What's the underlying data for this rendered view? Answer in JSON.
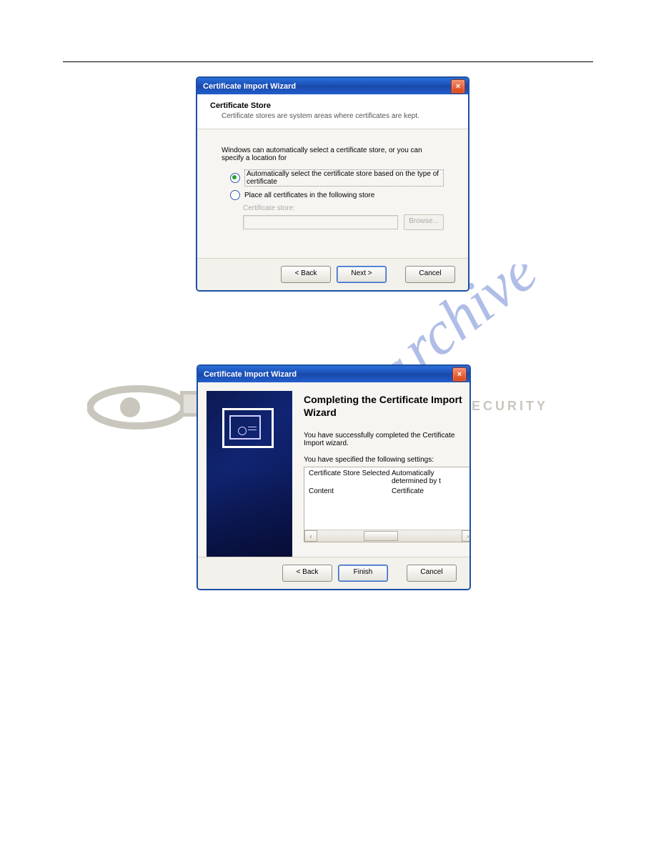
{
  "brand": {
    "watermark_text": "manualchive.com",
    "logo_text": "SECURITY",
    "tm": "®"
  },
  "dialog1": {
    "title": "Certificate Import Wizard",
    "header_title": "Certificate Store",
    "header_sub": "Certificate stores are system areas where certificates are kept.",
    "intro": "Windows can automatically select a certificate store, or you can specify a location for",
    "radio_auto": "Automatically select the certificate store based on the type of certificate",
    "radio_manual": "Place all certificates in the following store",
    "store_label": "Certificate store:",
    "store_value": "",
    "browse": "Browse...",
    "back": "< Back",
    "next": "Next >",
    "cancel": "Cancel",
    "close": "×"
  },
  "dialog2": {
    "title": "Certificate Import Wizard",
    "heading": "Completing the Certificate Import Wizard",
    "body1": "You have successfully completed the Certificate Import wizard.",
    "body2": "You have specified the following settings:",
    "rows": [
      {
        "key": "Certificate Store Selected",
        "val": "Automatically determined by t"
      },
      {
        "key": "Content",
        "val": "Certificate"
      }
    ],
    "scroll_left": "‹",
    "scroll_right": "›",
    "back": "< Back",
    "finish": "Finish",
    "cancel": "Cancel",
    "close": "×"
  }
}
